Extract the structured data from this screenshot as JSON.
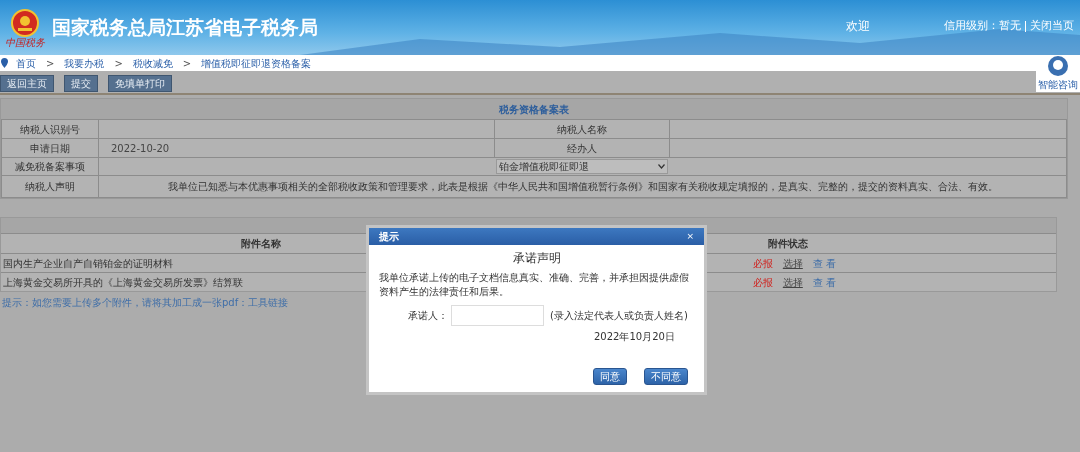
{
  "header": {
    "title": "国家税务总局江苏省电子税务局",
    "logo_caption": "中国税务",
    "welcome": "欢迎",
    "credit": "信用级别：暂无",
    "close_link": "关闭当页"
  },
  "breadcrumb": [
    {
      "kind": "link",
      "text": "首页"
    },
    {
      "kind": "separator",
      "text": ">"
    },
    {
      "kind": "link",
      "text": "我要办税"
    },
    {
      "kind": "separator",
      "text": ">"
    },
    {
      "kind": "link",
      "text": "税收减免"
    },
    {
      "kind": "separator",
      "text": ">"
    },
    {
      "kind": "link",
      "text": "增值税即征即退资格备案"
    }
  ],
  "assistant": {
    "label": "智能咨询"
  },
  "toolbar": [
    "返回主页",
    "提交",
    "免填单打印"
  ],
  "form": {
    "title": "税务资格备案表",
    "rows": [
      {
        "label": "纳税人识别号",
        "label2": "纳税人名称"
      },
      {
        "label": "申请日期",
        "value": "2022-10-20",
        "label2": "经办人"
      }
    ],
    "matter": {
      "label": "减免税备案事项",
      "selected_option": "铂金增值税即征即退"
    },
    "declaration": {
      "label": "纳税人声明",
      "text": "我单位已知悉与本优惠事项相关的全部税收政策和管理要求，此表是根据《中华人民共和国增值税暂行条例》和国家有关税收规定填报的，是真实、完整的，提交的资料真实、合法、有效。"
    }
  },
  "attachments": {
    "columns": [
      "附件名称",
      "附件状态"
    ],
    "rows": [
      {
        "name": "国内生产企业自产自销铂金的证明材料",
        "status": "必报",
        "choose": "选择",
        "view": "查 看"
      },
      {
        "name": "上海黄金交易所开具的《上海黄金交易所发票》结算联",
        "status": "必报",
        "choose": "选择",
        "view": "查 看"
      }
    ],
    "hint": "提示：如您需要上传多个附件，请将其加工成一张pdf：",
    "hint_link": "工具链接"
  },
  "dialog": {
    "title": "提示",
    "close": "×",
    "heading": "承诺声明",
    "text": "我单位承诺上传的电子文档信息真实、准确、完善，并承担因提供虚假资料产生的法律责任和后果。",
    "field_label": "承诺人：",
    "field_note": "(录入法定代表人或负责人姓名)",
    "date": "2022年10月20日",
    "buttons": [
      "同意",
      "不同意"
    ]
  }
}
